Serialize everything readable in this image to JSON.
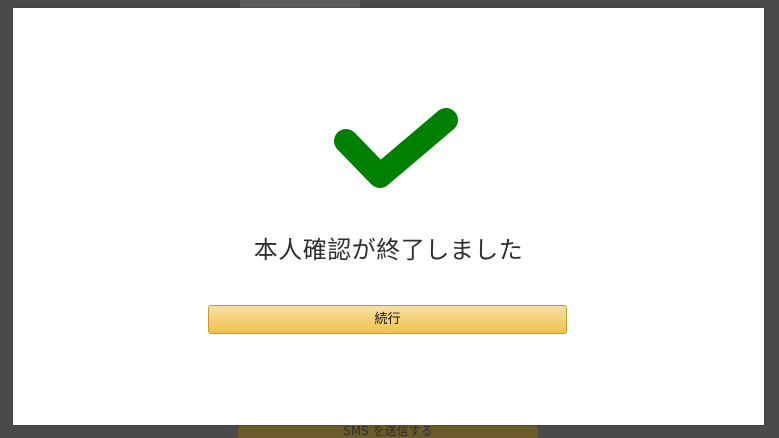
{
  "background": {
    "sms_button_label": "SMS を送信する"
  },
  "modal": {
    "icon": "check-icon",
    "icon_color": "#008000",
    "title": "本人確認が終了しました",
    "continue_label": "続行",
    "button_color": "#f0c14b"
  }
}
